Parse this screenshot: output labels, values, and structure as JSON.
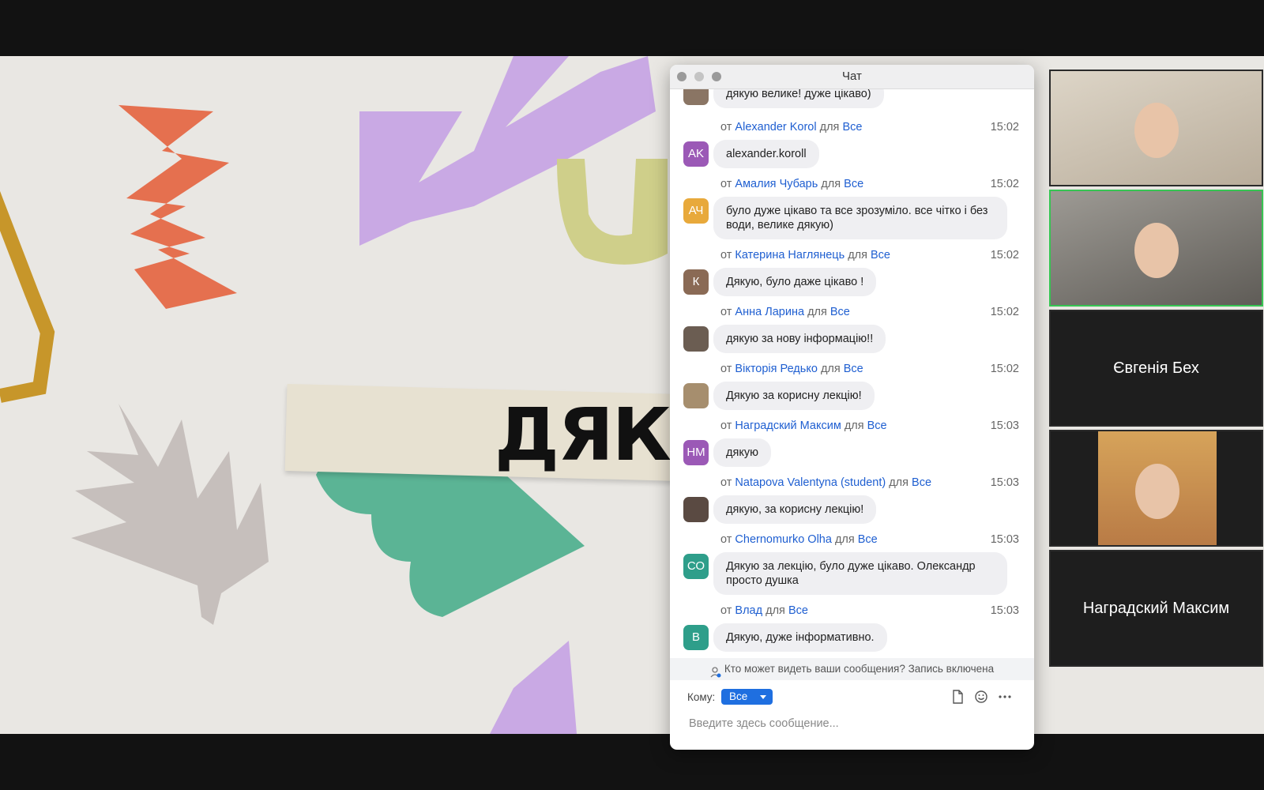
{
  "slide": {
    "title": "ДЯКУ"
  },
  "chat": {
    "window_title": "Чат",
    "messages": [
      {
        "from": "",
        "to": "",
        "time": "",
        "avatar_initials": "",
        "avatar_color": "",
        "text": "дякую велике! дуже цікаво)"
      },
      {
        "from": "Alexander Korol",
        "to": "Все",
        "time": "15:02",
        "avatar_initials": "AK",
        "avatar_color": "#9b59b6",
        "text": "alexander.koroll"
      },
      {
        "from": "Амалия Чубарь",
        "to": "Все",
        "time": "15:02",
        "avatar_initials": "АЧ",
        "avatar_color": "#e8a93b",
        "text": "було дуже цікаво та все зрозуміло. все чітко і без води, велике дякую)"
      },
      {
        "from": "Катерина Наглянець",
        "to": "Все",
        "time": "15:02",
        "avatar_initials": "К",
        "avatar_color": "#8a6a55",
        "text": "Дякую, було даже цікаво !"
      },
      {
        "from": "Анна Ларина",
        "to": "Все",
        "time": "15:02",
        "avatar_initials": "",
        "avatar_color": "#6b5d52",
        "text": "дякую за нову інформацію!!"
      },
      {
        "from": "Вікторія Редько",
        "to": "Все",
        "time": "15:02",
        "avatar_initials": "",
        "avatar_color": "#a68e6e",
        "text": "Дякую за корисну лекцію!"
      },
      {
        "from": "Наградский Максим",
        "to": "Все",
        "time": "15:03",
        "avatar_initials": "НМ",
        "avatar_color": "#9b59b6",
        "text": "дякую"
      },
      {
        "from": "Natapova Valentyna (student)",
        "to": "Все",
        "time": "15:03",
        "avatar_initials": "",
        "avatar_color": "#5a4a42",
        "text": "дякую, за корисну лекцію!"
      },
      {
        "from": "Chernomurko Olha",
        "to": "Все",
        "time": "15:03",
        "avatar_initials": "СО",
        "avatar_color": "#2e9e8a",
        "text": "Дякую за лекцію, було дуже цікаво. Олександр просто душка"
      },
      {
        "from": "Влад",
        "to": "Все",
        "time": "15:03",
        "avatar_initials": "В",
        "avatar_color": "#2e9e8a",
        "text": "Дякую, дуже інформативно."
      }
    ],
    "meta_prefix": "от",
    "meta_for": "для",
    "notice": "Кто может видеть ваши сообщения? Запись включена",
    "to_label": "Кому:",
    "to_value": "Все",
    "input_placeholder": "Введите здесь сообщение..."
  },
  "participants": [
    {
      "name": "",
      "video": true,
      "active": false
    },
    {
      "name": "",
      "video": true,
      "active": true
    },
    {
      "name": "Євгенія Бех",
      "video": false,
      "active": false
    },
    {
      "name": "",
      "video": true,
      "active": false
    },
    {
      "name": "Наградский Максим",
      "video": false,
      "active": false
    }
  ]
}
